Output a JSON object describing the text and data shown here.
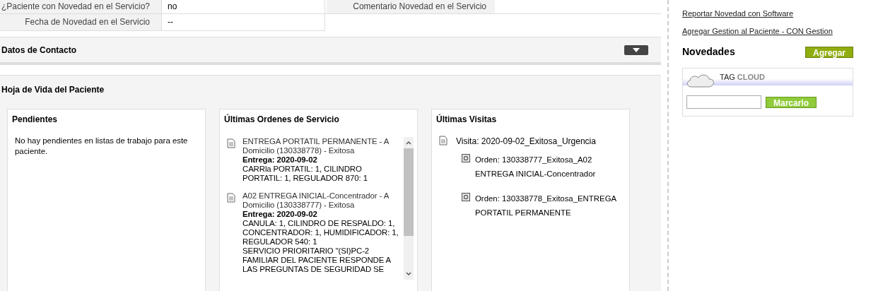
{
  "service_fields": [
    {
      "label": "¿Paciente con Novedad en el Servicio?",
      "value": "no",
      "label2": "Comentario Novedad en el Servicio"
    },
    {
      "label": "Fecha de Novedad en el Servicio",
      "value": "--"
    }
  ],
  "sections": [
    {
      "title": "Datos de Contacto",
      "expanded": false
    },
    {
      "title": "Hoja de Vida del Paciente",
      "expanded": true
    }
  ],
  "cards": [
    {
      "kind": "text",
      "title": "Pendientes",
      "text": "No hay pendientes en listas de trabajo para este paciente."
    },
    {
      "kind": "orders",
      "title": "Últimas Ordenes de Servicio",
      "orders": [
        {
          "title": "ENTREGA PORTATIL PERMANENTE - A Domicilio (130338778) - Exitosa",
          "delivery": "Entrega: 2020-09-02",
          "lines": [
            "CARRla PORTATIL: 1, CILINDRO PORTATIL: 1, REGULADOR 870: 1"
          ]
        },
        {
          "title": "A02 ENTREGA INICIAL-Concentrador - A Domicilio (130338777) - Exitosa",
          "delivery": "Entrega: 2020-09-02",
          "lines": [
            "CANULA: 1, CILINDRO DE RESPALDO: 1, CONCENTRADOR: 1, HUMIDIFICADOR: 1, REGULADOR 540: 1",
            "SERVICIO PRIORITARIO \"(SI)PC-2 FAMILIAR DEL PACIENTE RESPONDE A LAS PREGUNTAS DE SEGURIDAD SE"
          ]
        }
      ]
    },
    {
      "kind": "visits",
      "title": "Últimas Visitas",
      "visit": "Visita: 2020-09-02_Exitosa_Urgencia",
      "orders": [
        "Orden: 130338777_Exitosa_A02 ENTREGA INICIAL-Concentrador",
        "Orden: 130338778_Exitosa_ENTREGA PORTATIL PERMANENTE"
      ]
    }
  ],
  "sidebar": {
    "links": [
      "Reportar Novedad con Software",
      "Agregar Gestion al Paciente - CON Gestion"
    ],
    "novedades": {
      "title": "Novedades",
      "button": "Agregar"
    },
    "tag_cloud": {
      "title_1": "TAG",
      "title_2": "CLOUD",
      "button": "Marcarlo"
    }
  }
}
